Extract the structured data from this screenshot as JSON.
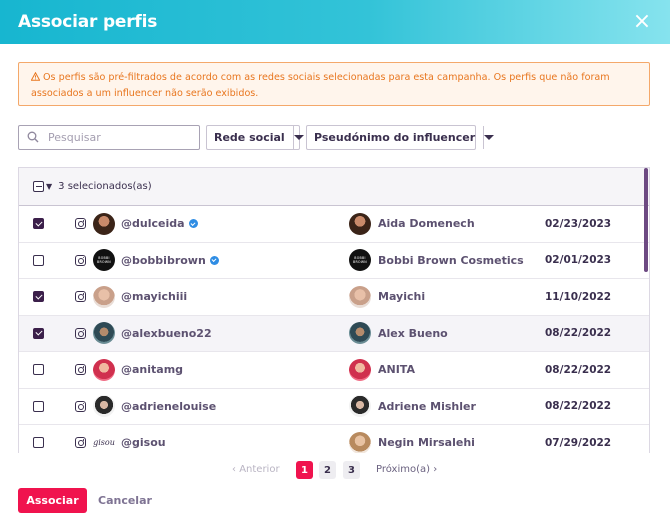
{
  "modal": {
    "title": "Associar perfis",
    "close_label": "×"
  },
  "alert": {
    "text": "Os perfis são pré-filtrados de acordo com as redes sociais selecionadas para esta campanha. Os perfis que não foram associados a um influencer não serão exibidos.",
    "color": "#e8761f"
  },
  "filters": {
    "search_placeholder": "Pesquisar",
    "social_network_label": "Rede social",
    "influencer_alias_label": "Pseudónimo do influencer"
  },
  "table": {
    "selected_count": "3 selecionados(as)",
    "rows": [
      {
        "checked": true,
        "network_icon": "instagram-icon",
        "handle": "@dulceida",
        "verified": true,
        "influencer": "Aida Domenech",
        "date": "02/23/2023"
      },
      {
        "checked": false,
        "network_icon": "instagram-icon",
        "handle": "@bobbibrown",
        "verified": true,
        "influencer": "Bobbi Brown Cosmetics",
        "date": "02/01/2023",
        "avatar_text": "BOBBI BROWN"
      },
      {
        "checked": true,
        "network_icon": "instagram-icon",
        "handle": "@mayichiii",
        "verified": false,
        "influencer": "Mayichi",
        "date": "11/10/2022"
      },
      {
        "checked": true,
        "network_icon": "instagram-icon",
        "handle": "@alexbueno22",
        "verified": false,
        "influencer": "Alex Bueno",
        "date": "08/22/2022"
      },
      {
        "checked": false,
        "network_icon": "instagram-icon",
        "handle": "@anitamg",
        "verified": false,
        "influencer": "ANITA",
        "date": "08/22/2022"
      },
      {
        "checked": false,
        "network_icon": "instagram-icon",
        "handle": "@adrienelouise",
        "verified": false,
        "influencer": "Adriene Mishler",
        "date": "08/22/2022"
      },
      {
        "checked": false,
        "network_icon": "instagram-icon",
        "handle": "@gisou",
        "verified": false,
        "influencer": "Negin Mirsalehi",
        "date": "07/29/2022",
        "avatar_text": "gisou"
      }
    ]
  },
  "pagination": {
    "prev_label": "Anterior",
    "next_label": "Próximo(a)",
    "pages": [
      "1",
      "2",
      "3"
    ],
    "current": "1"
  },
  "footer": {
    "primary_label": "Associar",
    "cancel_label": "Cancelar"
  },
  "colors": {
    "accent": "#f0134e",
    "header_gradient_start": "#17b6d0",
    "header_gradient_end": "#86e3ee",
    "dark": "#3a2f4e"
  }
}
